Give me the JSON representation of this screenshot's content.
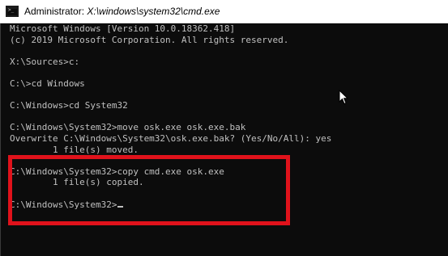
{
  "window": {
    "title_prefix": "Administrator: ",
    "title_path": "X:\\windows\\system32\\cmd.exe",
    "icon": "cmd-icon"
  },
  "console": {
    "lines": [
      "Microsoft Windows [Version 10.0.18362.418]",
      "(c) 2019 Microsoft Corporation. All rights reserved.",
      "",
      "X:\\Sources>c:",
      "",
      "C:\\>cd Windows",
      "",
      "C:\\Windows>cd System32",
      "",
      "C:\\Windows\\System32>move osk.exe osk.exe.bak",
      "Overwrite C:\\Windows\\System32\\osk.exe.bak? (Yes/No/All): yes",
      "        1 file(s) moved.",
      "",
      "C:\\Windows\\System32>copy cmd.exe osk.exe",
      "        1 file(s) copied.",
      "",
      "C:\\Windows\\System32>"
    ]
  },
  "colors": {
    "console_background": "#0c0c0c",
    "console_text": "#c0c0c0",
    "highlight_border": "#e0121b",
    "titlebar_background": "#ffffff"
  },
  "icons": {
    "mouse_pointer": "arrow-cursor-icon",
    "text_cursor": "underscore-caret"
  }
}
